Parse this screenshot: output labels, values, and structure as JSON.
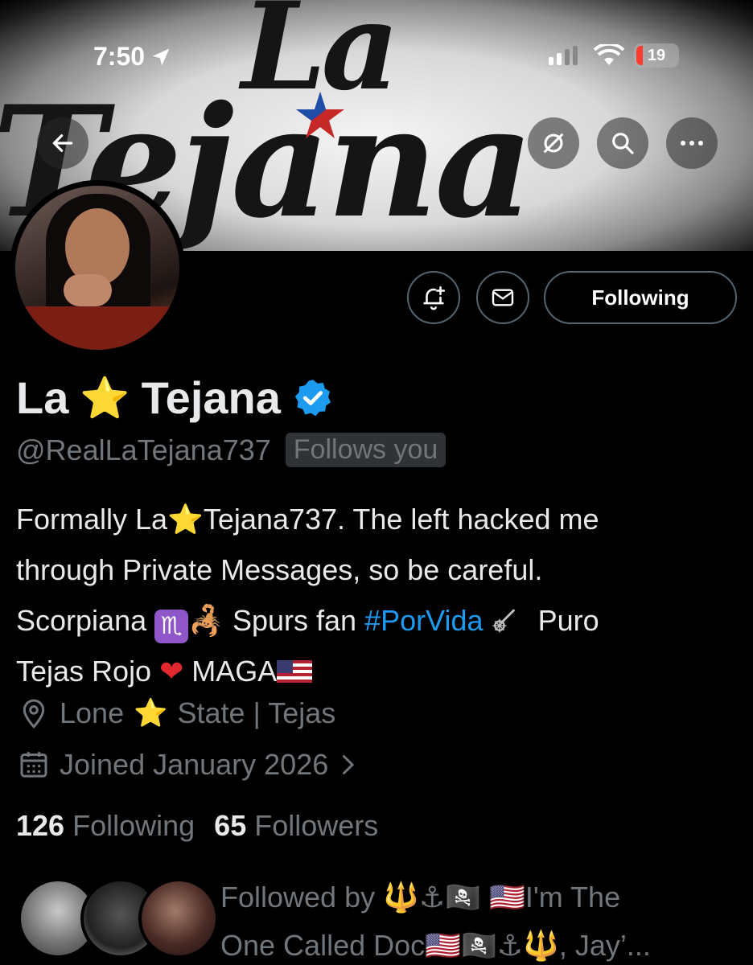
{
  "status_bar": {
    "time": "7:50",
    "battery": "19"
  },
  "banner": {
    "text_la": "La",
    "text_tejana": "Tejana"
  },
  "profile": {
    "name_part1": "La",
    "name_star": "⭐",
    "name_part2": "Tejana",
    "handle": "@RealLaTejana737",
    "follows_you": "Follows you",
    "following_label": "Following"
  },
  "bio": {
    "line1": "Formally La⭐Tejana737. The left hacked me",
    "line2": "through Private Messages, so be careful.",
    "line3_a": "Scorpiana",
    "line3_zodiac": "♏",
    "line3_scorpion": "🦂",
    "line3_b": "Spurs fan",
    "line3_hashtag": "#PorVida",
    "line3_c": "Puro",
    "line4_a": "Tejas Rojo",
    "line4_heart": "❤",
    "line4_b": "MAGA"
  },
  "location": {
    "part1": "Lone",
    "star": "⭐",
    "part2": "State | Tejas"
  },
  "joined": "Joined January 2026",
  "stats": {
    "following_count": "126",
    "following_label": "Following",
    "followers_count": "65",
    "followers_label": "Followers"
  },
  "followed_by": {
    "line1": "Followed by 🔱⚓🏴‍☠️ 🇺🇸I'm The",
    "line2": "One Called Doc🇺🇸🏴‍☠️⚓🔱, Jay’..."
  },
  "colors": {
    "accent": "#1d9bf0",
    "verified": "#1d9bf0",
    "muted": "#71767b",
    "text": "#e7e9ea"
  }
}
